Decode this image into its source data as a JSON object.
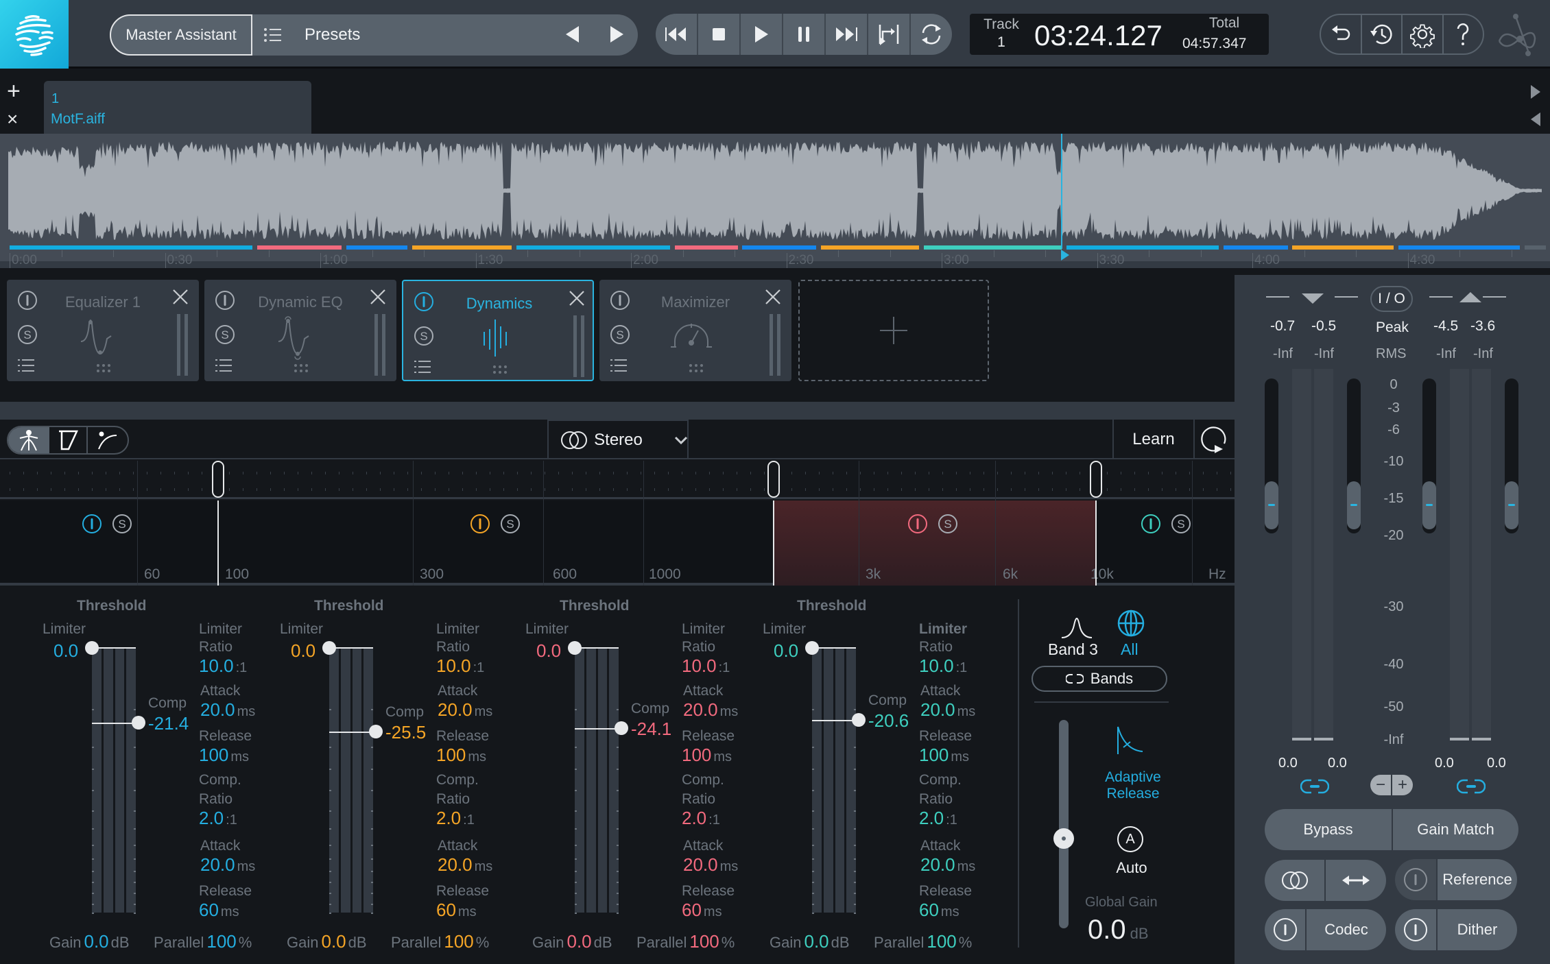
{
  "header": {
    "master_assistant": "Master Assistant",
    "presets": "Presets",
    "track_label": "Track",
    "track_number": "1",
    "current_time": "03:24.127",
    "total_label": "Total",
    "total_time": "04:57.347",
    "transport": [
      "rewind-to-start",
      "stop",
      "play",
      "pause",
      "skip-to-end",
      "loop-region",
      "loop"
    ],
    "utilities": [
      "undo",
      "history",
      "settings",
      "help"
    ]
  },
  "tracks": {
    "tab": {
      "number": "1",
      "filename": "MotF.aiff"
    }
  },
  "timeline": {
    "ruler": [
      "0:00",
      "0:30",
      "1:00",
      "1:30",
      "2:00",
      "2:30",
      "3:00",
      "3:30",
      "4:00",
      "4:30"
    ],
    "playhead_time": "03:24.127",
    "segments": [
      {
        "color": "#12ade0",
        "start": 0,
        "end": 0.158
      },
      {
        "color": "#f26a7e",
        "start": 0.161,
        "end": 0.216
      },
      {
        "color": "#1487ee",
        "start": 0.219,
        "end": 0.259
      },
      {
        "color": "#f5a526",
        "start": 0.262,
        "end": 0.327
      },
      {
        "color": "#12ade0",
        "start": 0.33,
        "end": 0.43
      },
      {
        "color": "#f26a7e",
        "start": 0.433,
        "end": 0.474
      },
      {
        "color": "#1487ee",
        "start": 0.477,
        "end": 0.525
      },
      {
        "color": "#f5a526",
        "start": 0.528,
        "end": 0.592
      },
      {
        "color": "#3ecfbf",
        "start": 0.595,
        "end": 0.685
      },
      {
        "color": "#12ade0",
        "start": 0.688,
        "end": 0.787
      },
      {
        "color": "#1487ee",
        "start": 0.79,
        "end": 0.832
      },
      {
        "color": "#f5a526",
        "start": 0.835,
        "end": 0.901
      },
      {
        "color": "#1487ee",
        "start": 0.904,
        "end": 0.983
      },
      {
        "color": "#58626c",
        "start": 0.986,
        "end": 1.0
      }
    ]
  },
  "modules": [
    {
      "title": "Equalizer 1",
      "icon": "eq-curve-icon",
      "active": false
    },
    {
      "title": "Dynamic EQ",
      "icon": "dynamic-eq-curve-icon",
      "active": false
    },
    {
      "title": "Dynamics",
      "icon": "dynamics-waveform-icon",
      "active": true
    },
    {
      "title": "Maximizer",
      "icon": "gauge-icon",
      "active": false
    }
  ],
  "toolbar": {
    "modes": [
      "Learn mode person",
      "Threshold mode",
      "Curve mode"
    ],
    "stereo_mode": "Stereo",
    "learn": "Learn"
  },
  "crossover": {
    "frequency_labels": [
      "60",
      "100",
      "300",
      "600",
      "1000",
      "3k",
      "6k",
      "10k",
      "Hz"
    ],
    "crossover_points_hz": [
      100,
      2000,
      10000
    ],
    "selected_band": 3
  },
  "bands": [
    {
      "color": "#24aee0",
      "threshold_label": "Threshold",
      "limiter_label": "Limiter",
      "limiter_threshold": "0.0",
      "comp_label": "Comp",
      "comp_threshold": "-21.4",
      "limiter_ratio": "10.0",
      "limiter_attack": "20.0",
      "limiter_release": "100",
      "comp_ratio": "2.0",
      "comp_attack": "20.0",
      "comp_release": "60",
      "gain": "0.0",
      "parallel": "100",
      "comp_threshold_fraction": 0.28
    },
    {
      "color": "#f5a526",
      "threshold_label": "Threshold",
      "limiter_label": "Limiter",
      "limiter_threshold": "0.0",
      "comp_label": "Comp",
      "comp_threshold": "-25.5",
      "limiter_ratio": "10.0",
      "limiter_attack": "20.0",
      "limiter_release": "100",
      "comp_ratio": "2.0",
      "comp_attack": "20.0",
      "comp_release": "60",
      "gain": "0.0",
      "parallel": "100",
      "comp_threshold_fraction": 0.315
    },
    {
      "color": "#f26a7e",
      "threshold_label": "Threshold",
      "limiter_label": "Limiter",
      "limiter_threshold": "0.0",
      "comp_label": "Comp",
      "comp_threshold": "-24.1",
      "limiter_ratio": "10.0",
      "limiter_attack": "20.0",
      "limiter_release": "100",
      "comp_ratio": "2.0",
      "comp_attack": "20.0",
      "comp_release": "60",
      "gain": "0.0",
      "parallel": "100",
      "comp_threshold_fraction": 0.3
    },
    {
      "color": "#3ecfbf",
      "threshold_label": "Threshold",
      "limiter_label": "Limiter",
      "limiter_threshold": "0.0",
      "comp_label": "Comp",
      "comp_threshold": "-20.6",
      "limiter_ratio": "10.0",
      "limiter_attack": "20.0",
      "limiter_release": "100",
      "comp_ratio": "2.0",
      "comp_attack": "20.0",
      "comp_release": "60",
      "gain": "0.0",
      "parallel": "100",
      "comp_threshold_fraction": 0.27
    }
  ],
  "labels": {
    "limiter": "Limiter",
    "ratio": "Ratio",
    "attack": "Attack",
    "release": "Release",
    "comp_dot": "Comp.",
    "gain": "Gain",
    "parallel": "Parallel",
    "ms": "ms",
    "db": "dB",
    "pct": "%",
    "ratio_suffix": ":1"
  },
  "side": {
    "band_label": "Band 3",
    "all_label": "All",
    "link_bands": "Bands",
    "adaptive_release": [
      "Adaptive",
      "Release"
    ],
    "auto": "Auto",
    "global_gain_label": "Global Gain",
    "global_gain": "0.0",
    "global_gain_unit": "dB"
  },
  "io": {
    "io_label": "I / O",
    "input_peak": [
      "-0.7",
      "-0.5"
    ],
    "output_peak": [
      "-4.5",
      "-3.6"
    ],
    "input_rms": [
      "-Inf",
      "-Inf"
    ],
    "output_rms": [
      "-Inf",
      "-Inf"
    ],
    "peak_label": "Peak",
    "rms_label": "RMS",
    "scale": [
      "0",
      "-3",
      "-6",
      "-10",
      "-15",
      "-20",
      "-30",
      "-40",
      "-50",
      "-Inf"
    ],
    "input_gain": [
      "0.0",
      "0.0"
    ],
    "output_gain": [
      "0.0",
      "0.0"
    ]
  },
  "footer": {
    "bypass": "Bypass",
    "gain_match": "Gain Match",
    "reference": "Reference",
    "codec": "Codec",
    "dither": "Dither"
  }
}
